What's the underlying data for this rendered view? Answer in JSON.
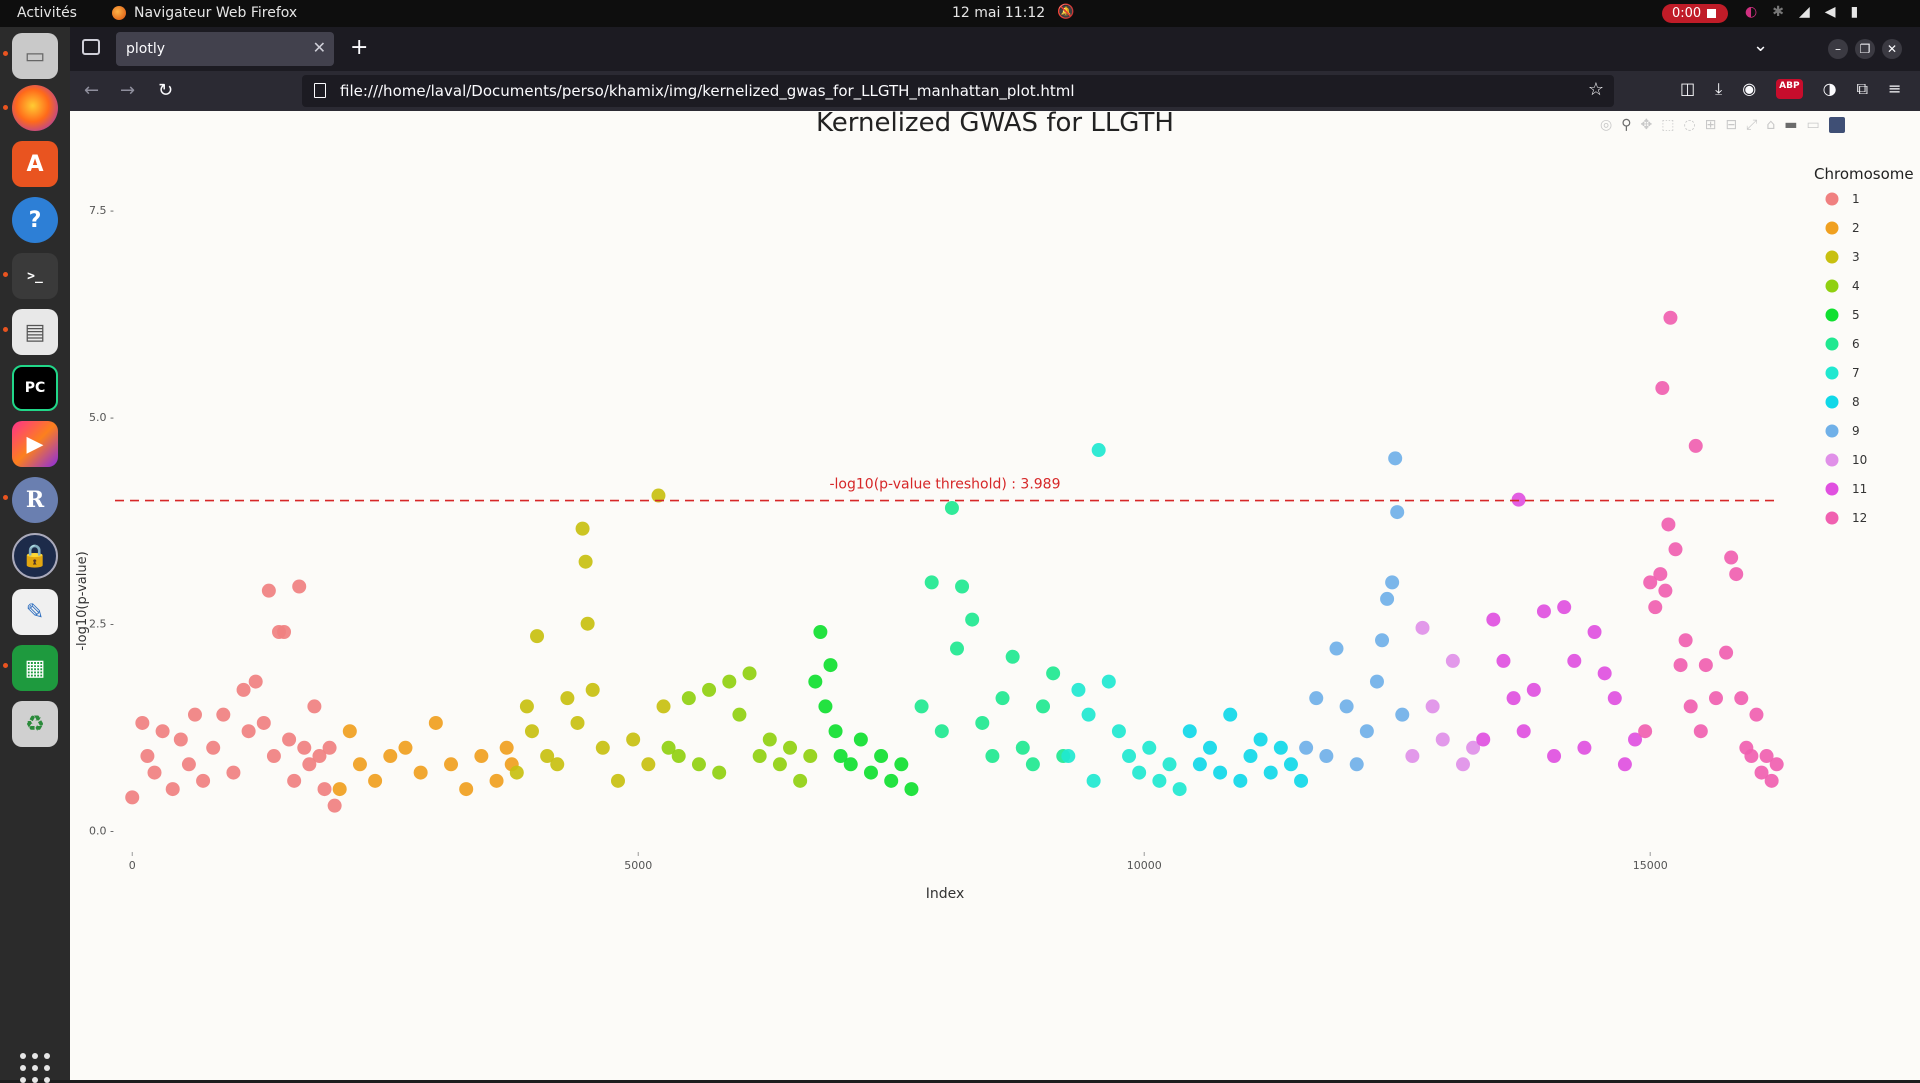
{
  "topbar": {
    "activities": "Activités",
    "app_name": "Navigateur Web Firefox",
    "clock": "12 mai  11:12",
    "recording": "0:00"
  },
  "browser": {
    "tab_title": "plotly",
    "url": "file:///home/laval/Documents/perso/khamix/img/kernelized_gwas_for_LLGTH_manhattan_plot.html"
  },
  "dock": {
    "items": [
      "files",
      "firefox",
      "app-center",
      "help",
      "terminal",
      "document-viewer",
      "pycharm",
      "jetbrains-toolbox",
      "r",
      "password-manager",
      "text-editor",
      "spreadsheet",
      "trash"
    ]
  },
  "chart_data": {
    "type": "scatter",
    "title": "Kernelized GWAS for LLGTH",
    "xlabel": "Index",
    "ylabel": "-log10(p-value)",
    "xlim": [
      -200,
      16500
    ],
    "ylim": [
      -0.2,
      8.7
    ],
    "xticks": [
      0,
      5000,
      10000,
      15000
    ],
    "yticks": [
      0.0,
      2.5,
      5.0,
      7.5
    ],
    "threshold": {
      "value": 3.989,
      "label": "-log10(p-value threshold) : 3.989",
      "color": "#d62728"
    },
    "legend": {
      "title": "Chromosome",
      "position": "right"
    },
    "series": [
      {
        "name": "1",
        "color": "#f08080",
        "x": [
          0,
          100,
          150,
          220,
          300,
          400,
          480,
          560,
          620,
          700,
          800,
          900,
          1000,
          1100,
          1150,
          1220,
          1300,
          1350,
          1400,
          1450,
          1500,
          1550,
          1600,
          1650,
          1700,
          1750,
          1800,
          1850,
          1900,
          1950,
          2000
        ],
        "y": [
          0.4,
          1.3,
          0.9,
          0.7,
          1.2,
          0.5,
          1.1,
          0.8,
          1.4,
          0.6,
          1.0,
          1.4,
          0.7,
          1.7,
          1.2,
          1.8,
          1.3,
          2.9,
          0.9,
          2.4,
          2.4,
          1.1,
          0.6,
          2.95,
          1.0,
          0.8,
          1.5,
          0.9,
          0.5,
          1.0,
          0.3
        ]
      },
      {
        "name": "2",
        "color": "#f0a020",
        "x": [
          2050,
          2150,
          2250,
          2400,
          2550,
          2700,
          2850,
          3000,
          3150,
          3300,
          3450,
          3600,
          3700,
          3750
        ],
        "y": [
          0.5,
          1.2,
          0.8,
          0.6,
          0.9,
          1.0,
          0.7,
          1.3,
          0.8,
          0.5,
          0.9,
          0.6,
          1.0,
          0.8
        ]
      },
      {
        "name": "3",
        "color": "#c8c010",
        "x": [
          3800,
          3900,
          3950,
          4000,
          4100,
          4200,
          4300,
          4400,
          4450,
          4480,
          4500,
          4550,
          4650,
          4800,
          4950,
          5100,
          5200,
          5250
        ],
        "y": [
          0.7,
          1.5,
          1.2,
          2.35,
          0.9,
          0.8,
          1.6,
          1.3,
          3.65,
          3.25,
          2.5,
          1.7,
          1.0,
          0.6,
          1.1,
          0.8,
          4.05,
          1.5
        ]
      },
      {
        "name": "4",
        "color": "#90d010",
        "x": [
          5300,
          5400,
          5500,
          5600,
          5700,
          5800,
          5900,
          6000,
          6100,
          6200,
          6300,
          6400,
          6500,
          6600,
          6700
        ],
        "y": [
          1.0,
          0.9,
          1.6,
          0.8,
          1.7,
          0.7,
          1.8,
          1.4,
          1.9,
          0.9,
          1.1,
          0.8,
          1.0,
          0.6,
          0.9
        ]
      },
      {
        "name": "5",
        "color": "#10e030",
        "x": [
          6750,
          6800,
          6850,
          6900,
          6950,
          7000,
          7100,
          7200,
          7300,
          7400,
          7500,
          7600,
          7700
        ],
        "y": [
          1.8,
          2.4,
          1.5,
          2.0,
          1.2,
          0.9,
          0.8,
          1.1,
          0.7,
          0.9,
          0.6,
          0.8,
          0.5
        ]
      },
      {
        "name": "6",
        "color": "#20e890",
        "x": [
          7800,
          7900,
          8000,
          8100,
          8150,
          8200,
          8300,
          8400,
          8500,
          8600,
          8700,
          8800,
          8900,
          9000,
          9100,
          9200
        ],
        "y": [
          1.5,
          3.0,
          1.2,
          3.9,
          2.2,
          2.95,
          2.55,
          1.3,
          0.9,
          1.6,
          2.1,
          1.0,
          0.8,
          1.5,
          1.9,
          0.9
        ]
      },
      {
        "name": "7",
        "color": "#20e8d0",
        "x": [
          9250,
          9350,
          9450,
          9500,
          9550,
          9650,
          9750,
          9850,
          9950,
          10050,
          10150,
          10250,
          10350
        ],
        "y": [
          0.9,
          1.7,
          1.4,
          0.6,
          4.6,
          1.8,
          1.2,
          0.9,
          0.7,
          1.0,
          0.6,
          0.8,
          0.5
        ]
      },
      {
        "name": "8",
        "color": "#10d8e8",
        "x": [
          10450,
          10550,
          10650,
          10750,
          10850,
          10950,
          11050,
          11150,
          11250,
          11350,
          11450,
          11550
        ],
        "y": [
          1.2,
          0.8,
          1.0,
          0.7,
          1.4,
          0.6,
          0.9,
          1.1,
          0.7,
          1.0,
          0.8,
          0.6
        ]
      },
      {
        "name": "9",
        "color": "#70b0e8",
        "x": [
          11600,
          11700,
          11800,
          11900,
          12000,
          12100,
          12200,
          12300,
          12350,
          12400,
          12450,
          12480,
          12500,
          12550
        ],
        "y": [
          1.0,
          1.6,
          0.9,
          2.2,
          1.5,
          0.8,
          1.2,
          1.8,
          2.3,
          2.8,
          3.0,
          4.5,
          3.85,
          1.4
        ]
      },
      {
        "name": "10",
        "color": "#e090e8",
        "x": [
          12650,
          12750,
          12850,
          12950,
          13050,
          13150,
          13250
        ],
        "y": [
          0.9,
          2.45,
          1.5,
          1.1,
          2.05,
          0.8,
          1.0
        ]
      },
      {
        "name": "11",
        "color": "#e050e0",
        "x": [
          13350,
          13450,
          13550,
          13650,
          13700,
          13750,
          13850,
          13950,
          14050,
          14150,
          14250,
          14350,
          14450,
          14550,
          14650,
          14750,
          14850
        ],
        "y": [
          1.1,
          2.55,
          2.05,
          1.6,
          4.0,
          1.2,
          1.7,
          2.65,
          0.9,
          2.7,
          2.05,
          1.0,
          2.4,
          1.9,
          1.6,
          0.8,
          1.1
        ]
      },
      {
        "name": "12",
        "color": "#f060b0",
        "x": [
          14950,
          15000,
          15050,
          15100,
          15120,
          15150,
          15180,
          15200,
          15250,
          15300,
          15350,
          15400,
          15450,
          15500,
          15550,
          15650,
          15750,
          15800,
          15850,
          15900,
          15950,
          16000,
          16050,
          16100,
          16150,
          16200,
          16250
        ],
        "y": [
          1.2,
          3.0,
          2.7,
          3.1,
          5.35,
          2.9,
          3.7,
          6.2,
          3.4,
          2.0,
          2.3,
          1.5,
          4.65,
          1.2,
          2.0,
          1.6,
          2.15,
          3.3,
          3.1,
          1.6,
          1.0,
          0.9,
          1.4,
          0.7,
          0.9,
          0.6,
          0.8
        ]
      }
    ]
  }
}
